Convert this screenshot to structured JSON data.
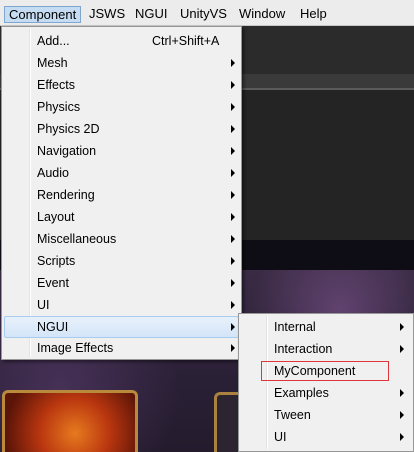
{
  "menubar": {
    "items": [
      {
        "label": "Component",
        "active": true
      },
      {
        "label": "JSWS"
      },
      {
        "label": "NGUI"
      },
      {
        "label": "UnityVS"
      },
      {
        "label": "Window"
      },
      {
        "label": "Help"
      }
    ]
  },
  "component_menu": {
    "items": [
      {
        "label": "Add...",
        "shortcut": "Ctrl+Shift+A",
        "submenu": false
      },
      {
        "label": "Mesh",
        "submenu": true
      },
      {
        "label": "Effects",
        "submenu": true
      },
      {
        "label": "Physics",
        "submenu": true
      },
      {
        "label": "Physics 2D",
        "submenu": true
      },
      {
        "label": "Navigation",
        "submenu": true
      },
      {
        "label": "Audio",
        "submenu": true
      },
      {
        "label": "Rendering",
        "submenu": true
      },
      {
        "label": "Layout",
        "submenu": true
      },
      {
        "label": "Miscellaneous",
        "submenu": true
      },
      {
        "label": "Scripts",
        "submenu": true
      },
      {
        "label": "Event",
        "submenu": true
      },
      {
        "label": "UI",
        "submenu": true
      },
      {
        "label": "NGUI",
        "submenu": true,
        "highlighted": true
      },
      {
        "label": "Image Effects",
        "submenu": true
      }
    ]
  },
  "ngui_menu": {
    "items": [
      {
        "label": "Internal",
        "submenu": true
      },
      {
        "label": "Interaction",
        "submenu": true
      },
      {
        "label": "MyComponent",
        "submenu": false,
        "annotated": true
      },
      {
        "label": "Examples",
        "submenu": true
      },
      {
        "label": "Tween",
        "submenu": true
      },
      {
        "label": "UI",
        "submenu": true
      }
    ]
  },
  "colors": {
    "highlight": "#d3e5f8",
    "annotation_box": "#e0353a",
    "menu_background": "#f0f0f0"
  }
}
